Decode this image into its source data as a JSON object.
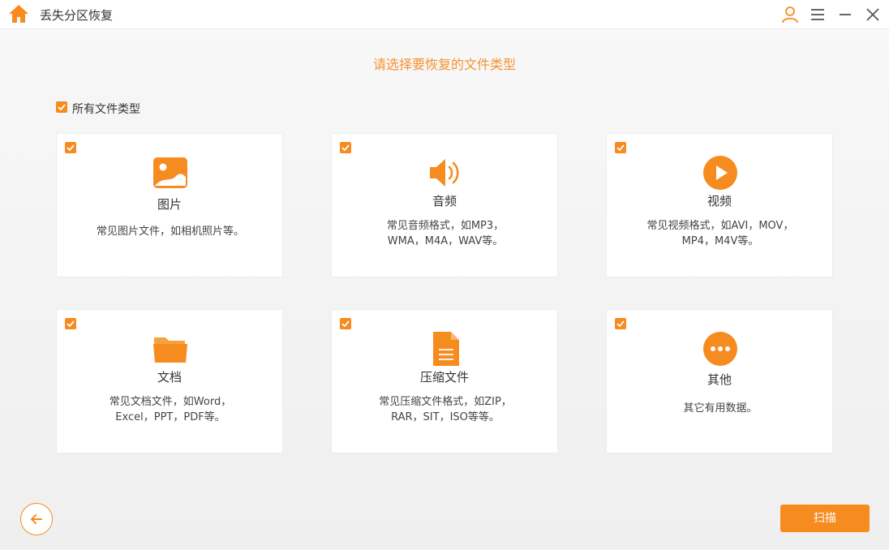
{
  "app": {
    "title": "丢失分区恢复"
  },
  "titlebar": {
    "icons": [
      "home-icon",
      "user-icon",
      "menu-icon",
      "minimize-icon",
      "close-icon"
    ]
  },
  "headline": "请选择要恢复的文件类型",
  "all_types": {
    "label": "所有文件类型",
    "checked": true
  },
  "cards": [
    {
      "title": "图片",
      "desc_lines": [
        "常见图片文件，如相机照片等。"
      ],
      "icon": "image-icon",
      "checked": true
    },
    {
      "title": "音频",
      "desc_lines": [
        "常见音频格式，如MP3，",
        "WMA，M4A，WAV等。"
      ],
      "icon": "speaker-icon",
      "checked": true
    },
    {
      "title": "视频",
      "desc_lines": [
        "常见视频格式，如AVI，MOV，",
        "MP4，M4V等。"
      ],
      "icon": "play-icon",
      "checked": true
    },
    {
      "title": "文档",
      "desc_lines": [
        "常见文档文件，如Word，",
        "Excel，PPT，PDF等。"
      ],
      "icon": "folder-icon",
      "checked": true
    },
    {
      "title": "压缩文件",
      "desc_lines": [
        "常见压缩文件格式，如ZIP，",
        "RAR，SIT，ISO等等。"
      ],
      "icon": "archive-file-icon",
      "checked": true
    },
    {
      "title": "其他",
      "desc_lines": [
        "其它有用数据。"
      ],
      "icon": "more-icon",
      "checked": true
    }
  ],
  "buttons": {
    "scan": "扫描"
  },
  "colors": {
    "accent": "#f68b1f",
    "headline": "#f5922f"
  }
}
